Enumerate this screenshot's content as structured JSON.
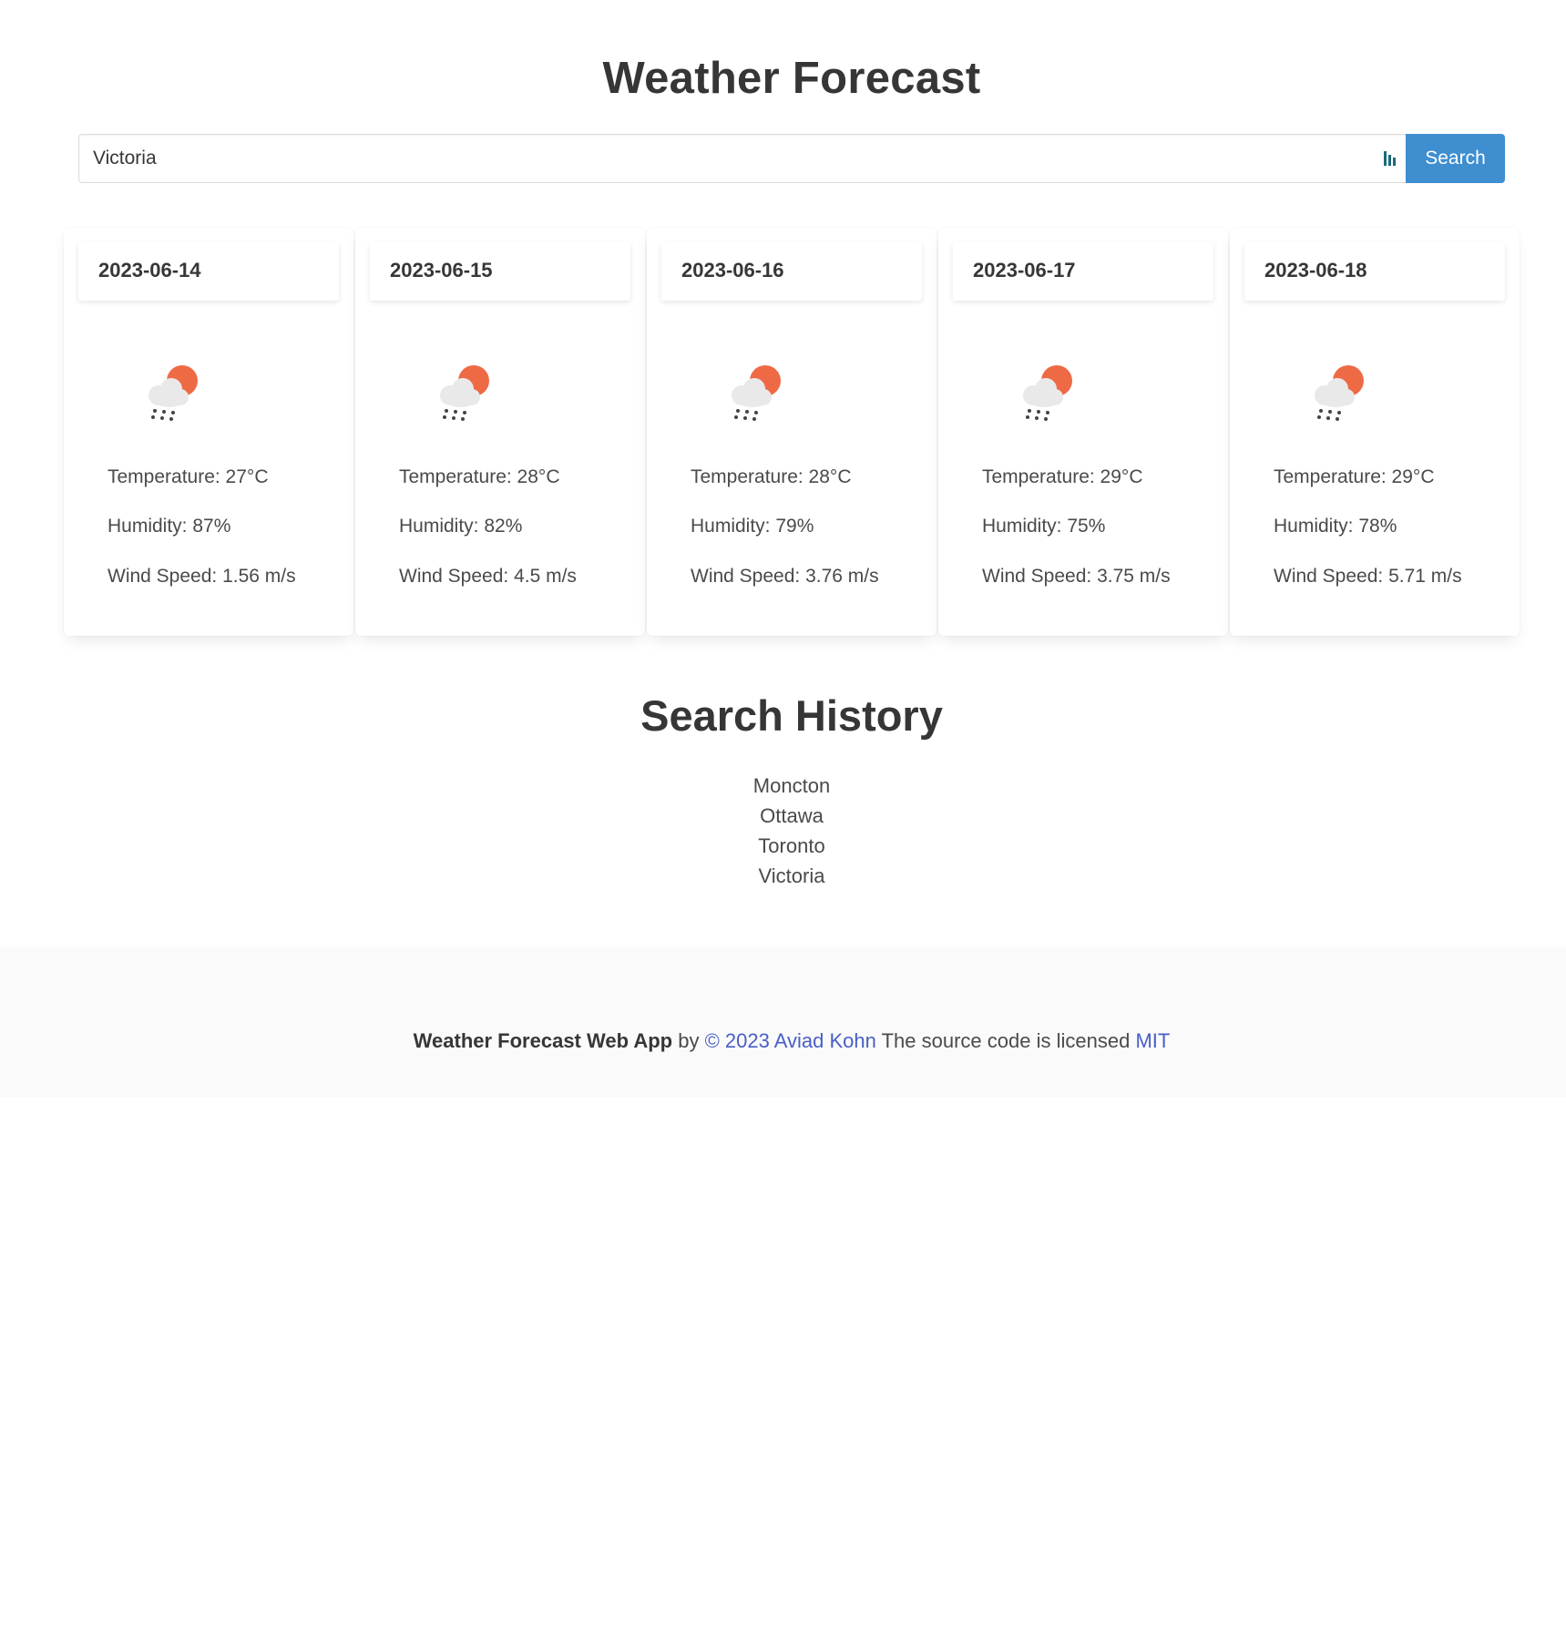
{
  "header": {
    "title": "Weather Forecast"
  },
  "search": {
    "value": "Victoria",
    "button_label": "Search"
  },
  "forecast": [
    {
      "date": "2023-06-14",
      "icon": "rain-cloud-sun-icon",
      "temperature": "Temperature: 27°C",
      "humidity": "Humidity: 87%",
      "wind": "Wind Speed: 1.56 m/s"
    },
    {
      "date": "2023-06-15",
      "icon": "rain-cloud-sun-icon",
      "temperature": "Temperature: 28°C",
      "humidity": "Humidity: 82%",
      "wind": "Wind Speed: 4.5 m/s"
    },
    {
      "date": "2023-06-16",
      "icon": "rain-cloud-sun-icon",
      "temperature": "Temperature: 28°C",
      "humidity": "Humidity: 79%",
      "wind": "Wind Speed: 3.76 m/s"
    },
    {
      "date": "2023-06-17",
      "icon": "rain-cloud-sun-icon",
      "temperature": "Temperature: 29°C",
      "humidity": "Humidity: 75%",
      "wind": "Wind Speed: 3.75 m/s"
    },
    {
      "date": "2023-06-18",
      "icon": "rain-cloud-sun-icon",
      "temperature": "Temperature: 29°C",
      "humidity": "Humidity: 78%",
      "wind": "Wind Speed: 5.71 m/s"
    }
  ],
  "history": {
    "title": "Search History",
    "items": [
      "Moncton",
      "Ottawa",
      "Toronto",
      "Victoria"
    ]
  },
  "footer": {
    "app_name": "Weather Forecast Web App",
    "by": "by",
    "author_link": "© 2023 Aviad Kohn",
    "license_text": "The source code is licensed",
    "license_link": "MIT"
  },
  "colors": {
    "accent": "#3e8ed0",
    "link": "#485fc7",
    "sun": "#ee6a45",
    "cloud": "#e9e9e9",
    "rain": "#444444"
  }
}
